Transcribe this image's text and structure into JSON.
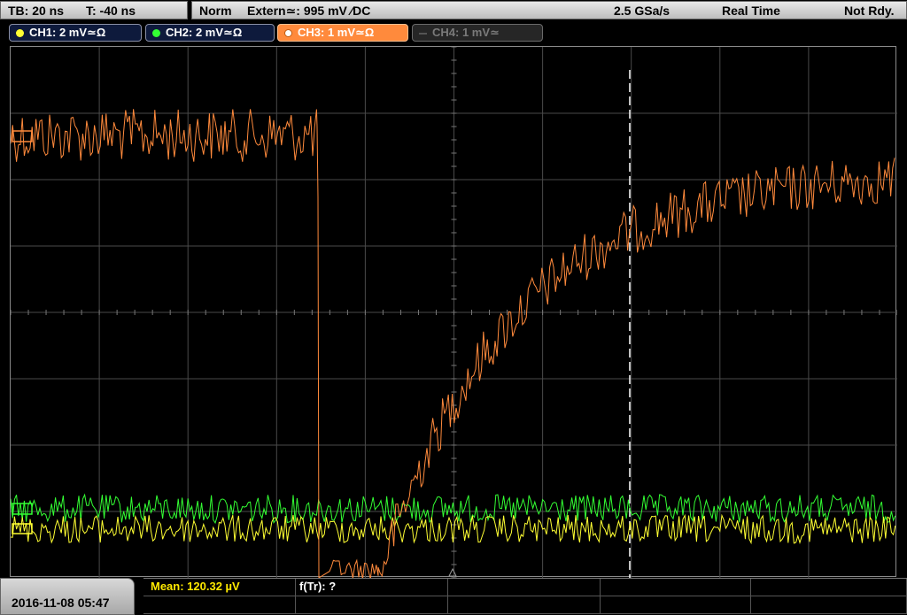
{
  "topbar": {
    "timebase": "TB: 20 ns",
    "trigger_time": "T: -40 ns",
    "mode": "Norm",
    "trigger_source": "Extern≃: 995 mV ∕DC",
    "sample_rate": "2.5 GSa/s",
    "acquisition": "Real Time",
    "status": "Not Rdy."
  },
  "channels": [
    {
      "label": "CH1: 2 mV≃Ω",
      "color": "#ffff33",
      "active": true
    },
    {
      "label": "CH2: 2 mV≃Ω",
      "color": "#33ff33",
      "active": true
    },
    {
      "label": "CH3: 1 mV≃Ω",
      "color": "#ff8a3c",
      "active": true,
      "selected": true
    },
    {
      "label": "CH4: 1 mV≃",
      "color": "#777777",
      "active": false
    }
  ],
  "trigger_marker": "T",
  "bottom": {
    "datetime": "2016-11-08 05:47",
    "measurement_mean": "Mean: 120.32 µV",
    "measurement_ftr": "f(Tr): ?"
  },
  "colors": {
    "ch1": "#ffff33",
    "ch2": "#33ff33",
    "ch3": "#ff8a3c",
    "grid": "#4a4a4a"
  }
}
